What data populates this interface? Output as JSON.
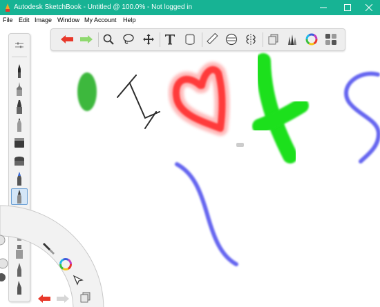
{
  "window": {
    "title": "Autodesk SketchBook - Untitled @ 100.0% - Not logged in",
    "controls": [
      "minimize-icon",
      "maximize-icon",
      "close-icon"
    ]
  },
  "menu": [
    {
      "label": "File"
    },
    {
      "label": "Edit"
    },
    {
      "label": "Image"
    },
    {
      "label": "Window"
    },
    {
      "label": "My Account"
    },
    {
      "label": "Help"
    }
  ],
  "colors": {
    "titlebar": "#17b394",
    "undo": "#e8382a",
    "redo": "#8fd96f",
    "stroke_green": "#3cb83c",
    "stroke_dark": "#2b2b2b",
    "stroke_red": "#ff3b3b",
    "stroke_lime": "#1ee01e",
    "stroke_blue": "#5555ee"
  },
  "toolbar": {
    "tools": [
      "undo-icon",
      "redo-icon",
      "zoom-icon",
      "lasso-icon",
      "move-icon",
      "text-icon",
      "fill-icon",
      "ruler-icon",
      "ellipse-guide-icon",
      "symmetry-icon",
      "layers-icon",
      "brush-library-icon",
      "color-wheel-icon",
      "palette-icon"
    ]
  },
  "brush_palette": {
    "brushes": [
      "brush-settings-icon",
      "ink-pen-icon",
      "technical-pen-icon",
      "marker-icon",
      "pencil-icon",
      "chisel-marker-icon",
      "flat-marker-icon",
      "airbrush-icon",
      "paintbrush-icon",
      "soft-brush-icon",
      "smudge-icon",
      "stamp-icon",
      "felt-pen-icon",
      "calligraphy-icon"
    ],
    "selected": "paintbrush-icon"
  },
  "lagoon": {
    "items": [
      "brush-icon",
      "color-puck-icon",
      "select-arrow-icon",
      "undo-icon",
      "redo-icon",
      "layers-icon"
    ]
  }
}
